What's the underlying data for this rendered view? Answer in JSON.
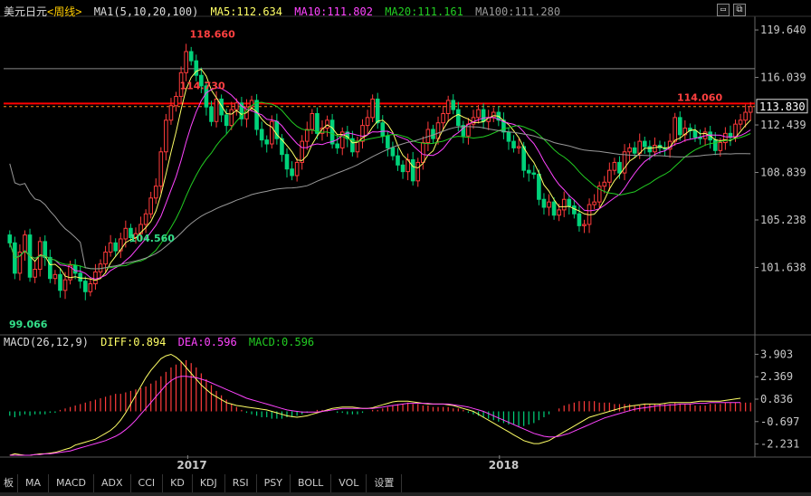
{
  "header": {
    "symbol": "美元日元",
    "period": "<周线>",
    "ma_label": "MA1(5,10,20,100)",
    "ma5": "MA5:112.634",
    "ma10": "MA10:111.802",
    "ma20": "MA20:111.161",
    "ma100": "MA100:111.280"
  },
  "window_buttons": [
    "▭",
    "⧉"
  ],
  "macd_header": {
    "label": "MACD(26,12,9)",
    "diff": "DIFF:0.894",
    "dea": "DEA:0.596",
    "macd": "MACD:0.596"
  },
  "tabs": [
    "板",
    "MA",
    "MACD",
    "ADX",
    "CCI",
    "KD",
    "KDJ",
    "RSI",
    "PSY",
    "BOLL",
    "VOL",
    "设置"
  ],
  "colors": {
    "up": "#ff3b3b",
    "down": "#00d27a",
    "ma5": "#ffff66",
    "ma10": "#ff44ff",
    "ma20": "#22cc22",
    "ma100": "#999999",
    "axis": "#aaaaaa",
    "resistance": "#ff0000"
  },
  "chart_data": {
    "type": "candlestick",
    "y_axis_ticks": [
      "119.640",
      "116.039",
      "112.439",
      "108.839",
      "105.238",
      "101.638"
    ],
    "y_range": [
      96.8,
      120.4
    ],
    "current_price": "113.830",
    "x_ticks": [
      "2017",
      "2018"
    ],
    "annotations": [
      {
        "text": "118.660",
        "value": 118.66
      },
      {
        "text": "114.730",
        "value": 114.73
      },
      {
        "text": "114.060",
        "value": 114.06
      },
      {
        "text": "104.560",
        "value": 104.56
      },
      {
        "text": "99.066",
        "value": 99.066
      }
    ],
    "resistance_level": 114.06,
    "gray_level": 116.7,
    "macd_ticks": [
      "3.903",
      "2.369",
      "0.836",
      "-0.697",
      "-2.231"
    ],
    "macd_range": [
      -3.0,
      4.3
    ],
    "close": [
      103.5,
      101.2,
      102.8,
      104.1,
      100.9,
      101.5,
      103.6,
      102.4,
      100.8,
      101.1,
      99.9,
      100.7,
      101.8,
      101.2,
      100.6,
      99.8,
      100.4,
      101.3,
      101.9,
      102.8,
      103.5,
      102.9,
      103.8,
      104.6,
      103.9,
      104.2,
      104.9,
      105.7,
      106.9,
      107.8,
      110.4,
      112.8,
      113.9,
      114.6,
      116.4,
      118.0,
      117.3,
      116.2,
      115.4,
      113.8,
      112.7,
      114.4,
      113.2,
      112.4,
      113.6,
      114.1,
      112.9,
      113.8,
      114.3,
      112.1,
      111.3,
      111.0,
      112.7,
      111.4,
      110.2,
      109.1,
      108.6,
      109.6,
      111.2,
      112.1,
      113.3,
      111.8,
      112.2,
      112.8,
      111.0,
      110.7,
      111.9,
      111.4,
      110.4,
      111.2,
      112.4,
      113.0,
      114.4,
      112.6,
      111.6,
      110.7,
      110.1,
      109.4,
      108.9,
      109.8,
      108.2,
      109.6,
      111.1,
      112.1,
      111.4,
      112.6,
      113.3,
      114.3,
      113.6,
      112.4,
      111.6,
      112.5,
      113.0,
      113.6,
      112.7,
      113.0,
      113.4,
      112.8,
      111.9,
      111.2,
      110.7,
      110.8,
      109.0,
      108.8,
      108.7,
      106.8,
      106.2,
      106.6,
      105.6,
      106.0,
      106.8,
      106.3,
      105.7,
      104.8,
      104.9,
      106.4,
      106.6,
      107.8,
      108.1,
      109.0,
      109.6,
      108.8,
      110.4,
      110.7,
      110.3,
      111.2,
      110.8,
      110.4,
      110.9,
      110.7,
      110.6,
      111.2,
      113.0,
      111.7,
      112.2,
      112.0,
      111.5,
      111.4,
      111.9,
      111.3,
      110.5,
      111.1,
      111.8,
      111.5,
      112.5,
      112.8,
      113.4,
      113.83
    ],
    "macd_hist": [
      -0.3,
      -0.4,
      -0.3,
      -0.2,
      -0.3,
      -0.2,
      -0.2,
      -0.2,
      -0.1,
      -0.1,
      0.1,
      0.2,
      0.3,
      0.4,
      0.5,
      0.6,
      0.7,
      0.8,
      0.9,
      1.0,
      1.1,
      1.2,
      1.2,
      1.3,
      1.4,
      1.5,
      1.6,
      1.7,
      1.9,
      2.1,
      2.4,
      2.7,
      3.0,
      3.2,
      3.4,
      3.5,
      3.3,
      3.0,
      2.6,
      2.2,
      1.8,
      1.4,
      1.1,
      0.8,
      0.5,
      0.3,
      0.1,
      -0.1,
      -0.2,
      -0.3,
      -0.4,
      -0.4,
      -0.5,
      -0.5,
      -0.5,
      -0.4,
      -0.4,
      -0.3,
      -0.2,
      -0.1,
      0.0,
      0.1,
      0.1,
      0.1,
      0.0,
      -0.1,
      -0.1,
      -0.2,
      -0.2,
      -0.2,
      -0.1,
      0.0,
      0.1,
      0.1,
      0.2,
      0.3,
      0.4,
      0.5,
      0.5,
      0.6,
      0.5,
      0.5,
      0.4,
      0.4,
      0.3,
      0.3,
      0.3,
      0.3,
      0.2,
      0.2,
      0.1,
      -0.1,
      -0.2,
      -0.3,
      -0.4,
      -0.5,
      -0.6,
      -0.7,
      -0.8,
      -0.9,
      -0.9,
      -1.0,
      -1.0,
      -0.9,
      -0.8,
      -0.6,
      -0.4,
      -0.2,
      0.0,
      0.2,
      0.4,
      0.5,
      0.6,
      0.7,
      0.7,
      0.7,
      0.7,
      0.6,
      0.6,
      0.6,
      0.5,
      0.5,
      0.5,
      0.5,
      0.4,
      0.4,
      0.5,
      0.5,
      0.5,
      0.5,
      0.5,
      0.5,
      0.6,
      0.5,
      0.5,
      0.5,
      0.4,
      0.4,
      0.4,
      0.5,
      0.5,
      0.5,
      0.6,
      0.6,
      0.6,
      0.6,
      0.6,
      0.6
    ],
    "macd_diff": [
      -3.0,
      -2.9,
      -2.95,
      -3.0,
      -3.0,
      -2.95,
      -2.9,
      -2.9,
      -2.85,
      -2.8,
      -2.7,
      -2.6,
      -2.5,
      -2.3,
      -2.2,
      -2.1,
      -2.0,
      -1.9,
      -1.7,
      -1.5,
      -1.3,
      -1.0,
      -0.6,
      -0.1,
      0.5,
      1.1,
      1.7,
      2.3,
      2.8,
      3.2,
      3.6,
      3.8,
      3.9,
      3.7,
      3.4,
      3.0,
      2.6,
      2.2,
      1.8,
      1.5,
      1.2,
      1.0,
      0.8,
      0.6,
      0.5,
      0.4,
      0.35,
      0.3,
      0.25,
      0.2,
      0.15,
      0.1,
      0.0,
      -0.1,
      -0.2,
      -0.3,
      -0.35,
      -0.4,
      -0.35,
      -0.3,
      -0.2,
      -0.1,
      0.0,
      0.1,
      0.2,
      0.25,
      0.3,
      0.3,
      0.3,
      0.25,
      0.2,
      0.2,
      0.25,
      0.35,
      0.45,
      0.55,
      0.65,
      0.7,
      0.7,
      0.7,
      0.65,
      0.6,
      0.55,
      0.5,
      0.5,
      0.5,
      0.5,
      0.45,
      0.4,
      0.3,
      0.2,
      0.1,
      0.0,
      -0.2,
      -0.4,
      -0.6,
      -0.8,
      -1.0,
      -1.2,
      -1.4,
      -1.6,
      -1.8,
      -2.0,
      -2.1,
      -2.2,
      -2.2,
      -2.1,
      -2.0,
      -1.8,
      -1.6,
      -1.4,
      -1.2,
      -1.0,
      -0.8,
      -0.6,
      -0.4,
      -0.3,
      -0.2,
      -0.1,
      0.0,
      0.1,
      0.2,
      0.3,
      0.35,
      0.4,
      0.45,
      0.5,
      0.5,
      0.5,
      0.5,
      0.55,
      0.6,
      0.6,
      0.6,
      0.6,
      0.6,
      0.65,
      0.7,
      0.7,
      0.7,
      0.7,
      0.7,
      0.75,
      0.8,
      0.85,
      0.9
    ],
    "macd_dea": [
      -3.0,
      -3.0,
      -3.0,
      -3.0,
      -3.0,
      -2.95,
      -2.95,
      -2.9,
      -2.9,
      -2.85,
      -2.8,
      -2.75,
      -2.7,
      -2.6,
      -2.5,
      -2.4,
      -2.3,
      -2.2,
      -2.1,
      -2.0,
      -1.85,
      -1.7,
      -1.5,
      -1.25,
      -0.95,
      -0.6,
      -0.2,
      0.2,
      0.6,
      1.0,
      1.4,
      1.8,
      2.1,
      2.3,
      2.4,
      2.4,
      2.35,
      2.3,
      2.2,
      2.1,
      1.95,
      1.8,
      1.65,
      1.5,
      1.35,
      1.2,
      1.05,
      0.9,
      0.8,
      0.7,
      0.6,
      0.5,
      0.4,
      0.3,
      0.2,
      0.1,
      0.05,
      0.0,
      -0.05,
      -0.05,
      -0.05,
      -0.05,
      0.0,
      0.05,
      0.1,
      0.15,
      0.2,
      0.2,
      0.2,
      0.2,
      0.2,
      0.2,
      0.2,
      0.25,
      0.3,
      0.35,
      0.4,
      0.45,
      0.5,
      0.55,
      0.55,
      0.55,
      0.55,
      0.55,
      0.5,
      0.5,
      0.5,
      0.5,
      0.45,
      0.4,
      0.35,
      0.3,
      0.2,
      0.1,
      0.0,
      -0.15,
      -0.3,
      -0.45,
      -0.6,
      -0.75,
      -0.9,
      -1.05,
      -1.2,
      -1.35,
      -1.5,
      -1.6,
      -1.7,
      -1.75,
      -1.75,
      -1.7,
      -1.6,
      -1.5,
      -1.35,
      -1.2,
      -1.05,
      -0.9,
      -0.75,
      -0.6,
      -0.45,
      -0.35,
      -0.25,
      -0.15,
      -0.05,
      0.05,
      0.15,
      0.2,
      0.25,
      0.3,
      0.35,
      0.4,
      0.4,
      0.45,
      0.45,
      0.5,
      0.5,
      0.5,
      0.55,
      0.55,
      0.55,
      0.6,
      0.6,
      0.6,
      0.6,
      0.6,
      0.6,
      0.6
    ]
  }
}
